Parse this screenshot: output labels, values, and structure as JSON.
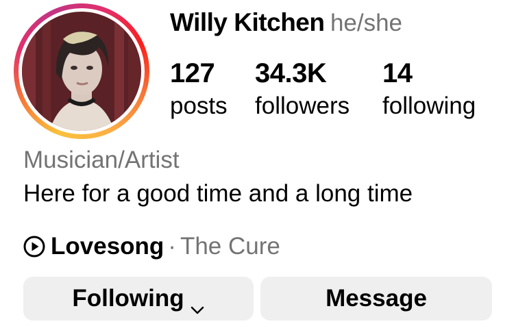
{
  "profile": {
    "name": "Willy Kitchen",
    "pronouns": "he/she",
    "category": "Musician/Artist",
    "bio": "Here for a good time and a long time"
  },
  "stats": [
    {
      "value": "127",
      "label": "posts"
    },
    {
      "value": "34.3K",
      "label": "followers"
    },
    {
      "value": "14",
      "label": "following"
    }
  ],
  "music": {
    "song": "Lovesong",
    "separator": "·",
    "artist": "The Cure",
    "icon": "play-circle-icon"
  },
  "buttons": {
    "following_label": "Following",
    "message_label": "Message"
  },
  "colors": {
    "secondary_text": "#737373",
    "button_bg": "#efefef",
    "story_ring_start": "#f9c23c",
    "story_ring_end": "#c13584"
  }
}
